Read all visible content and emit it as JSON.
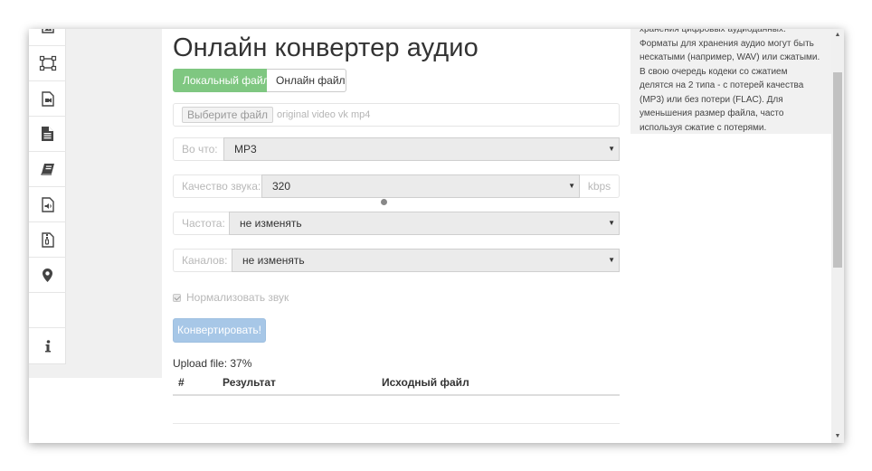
{
  "page": {
    "title": "Онлайн конвертер аудио"
  },
  "tabs": [
    {
      "label": "Локальный файл",
      "active": true
    },
    {
      "label": "Онлайн файл",
      "active": false
    }
  ],
  "file_input": {
    "button_label": "Выберите файл",
    "file_name": "original video vk mp4"
  },
  "form": {
    "format": {
      "label": "Во что:",
      "value": "MP3"
    },
    "quality": {
      "label": "Качество звука:",
      "value": "320",
      "suffix": "kbps"
    },
    "frequency": {
      "label": "Частота:",
      "value": "не изменять"
    },
    "channels": {
      "label": "Каналов:",
      "value": "не изменять"
    },
    "normalize": {
      "label": "Нормализовать звук",
      "checked": true
    },
    "caret": "▼"
  },
  "convert_button": "Конвертировать!",
  "upload_status": "Upload file: 37%",
  "upload_progress": 0.37,
  "table": {
    "headers": [
      "#",
      "Результат",
      "Исходный файл"
    ]
  },
  "sidebar": {
    "icons": [
      "image-icon",
      "crop-icon",
      "video-file-icon",
      "document-icon",
      "ebook-icon",
      "audio-file-icon",
      "archive-file-icon",
      "location-pin-icon",
      "info-icon"
    ]
  },
  "info_text": "хранения цифровых аудиоданных. Форматы для хранения аудио могут быть нескатыми (например, WAV) или сжатыми. В свою очередь кодеки со сжатием делятся на 2 типа - с потерей качества (MP3) или без потери (FLAC). Для уменьшения размер файла, часто используя сжатие с потерями.",
  "scrollbar": {
    "up": "▲",
    "down": "▼"
  },
  "colors": {
    "active_tab": "#7fc781",
    "convert_button": "#a7c7e7"
  }
}
